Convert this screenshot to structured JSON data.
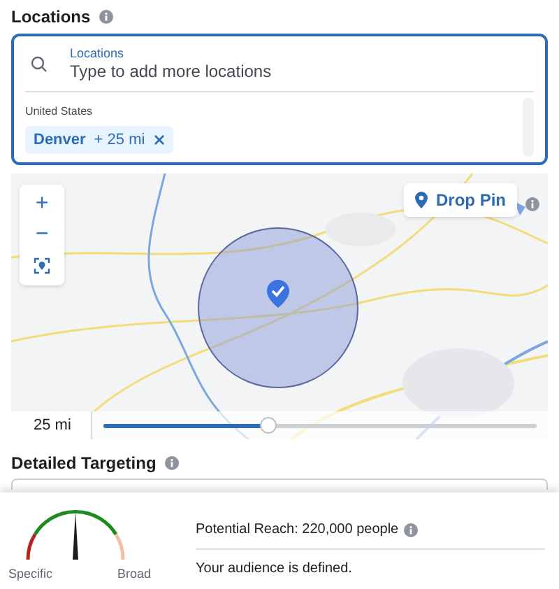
{
  "locations": {
    "title": "Locations",
    "search": {
      "label": "Locations",
      "placeholder": "Type to add more locations"
    },
    "country": "United States",
    "tags": [
      {
        "name": "Denver",
        "radius": "+ 25 mi"
      }
    ]
  },
  "map": {
    "kind": "picture",
    "zoom_in": "+",
    "zoom_out": "−",
    "drop_pin": "Drop Pin",
    "radius": {
      "reading": "25 mi",
      "level": 0.38
    }
  },
  "detailed_targeting": {
    "title": "Detailed Targeting"
  },
  "audience": {
    "gauge": {
      "level": 0.5,
      "min_label": "Specific",
      "max_label": "Broad"
    },
    "potential_reach": "Potential Reach: 220,000 people",
    "status": "Your audience is defined."
  }
}
